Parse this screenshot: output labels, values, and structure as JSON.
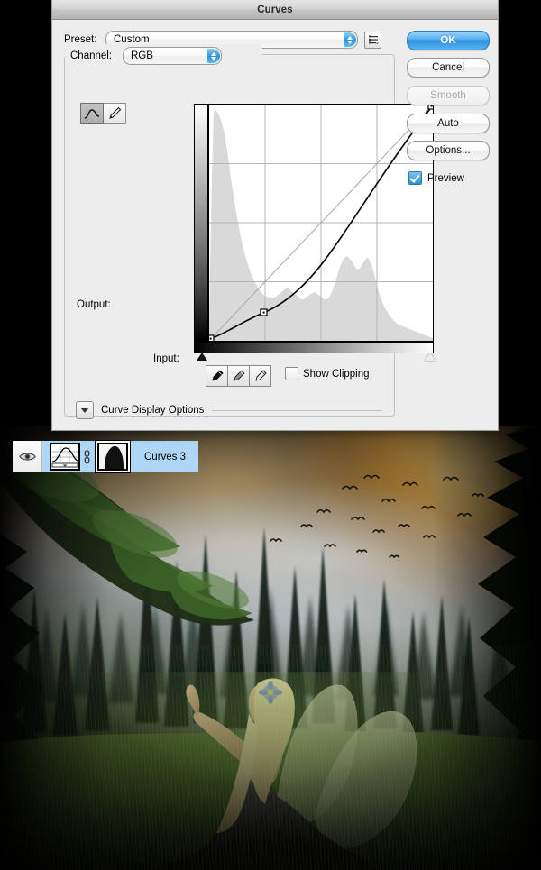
{
  "dialog": {
    "title": "Curves",
    "preset": {
      "label": "Preset:",
      "value": "Custom",
      "menu_icon": "preset-menu-icon"
    },
    "channel": {
      "label": "Channel:",
      "value": "RGB"
    },
    "tools": {
      "curve_icon": "curve-tool-icon",
      "pencil_icon": "pencil-tool-icon"
    },
    "output": {
      "label": "Output:",
      "value": ""
    },
    "input": {
      "label": "Input:",
      "value": ""
    },
    "eyedroppers": [
      {
        "name": "black-point-eyedropper-icon"
      },
      {
        "name": "gray-point-eyedropper-icon"
      },
      {
        "name": "white-point-eyedropper-icon"
      }
    ],
    "show_clipping": {
      "label": "Show Clipping",
      "checked": false
    },
    "curve_display_options": {
      "label": "Curve Display Options",
      "expanded": false,
      "icon": "disclosure-triangle-down-icon"
    },
    "buttons": {
      "ok": "OK",
      "cancel": "Cancel",
      "smooth": "Smooth",
      "auto": "Auto",
      "options": "Options..."
    },
    "preview": {
      "label": "Preview",
      "checked": true
    },
    "accent_color": "#2f8fdd"
  },
  "chart_data": {
    "type": "line",
    "title": "Curves (RGB)",
    "xlabel": "Input",
    "ylabel": "Output",
    "xlim": [
      0,
      255
    ],
    "ylim": [
      0,
      255
    ],
    "grid": true,
    "grid_divisions": 4,
    "series": [
      {
        "name": "baseline-diagonal",
        "style": "thin-gray",
        "x": [
          0,
          255
        ],
        "y": [
          0,
          255
        ]
      },
      {
        "name": "rgb-curve",
        "style": "black",
        "control_points": [
          {
            "input": 0,
            "output": 0
          },
          {
            "input": 62,
            "output": 30
          },
          {
            "input": 255,
            "output": 255
          }
        ],
        "x": [
          0,
          32,
          62,
          96,
          128,
          160,
          192,
          224,
          255
        ],
        "y": [
          0,
          14,
          30,
          52,
          80,
          116,
          158,
          204,
          255
        ]
      }
    ],
    "histogram": {
      "name": "image-histogram",
      "fill": "#d8d8d8",
      "bins": [
        6,
        62,
        98,
        100,
        97,
        94,
        90,
        86,
        80,
        74,
        68,
        62,
        56,
        50,
        45,
        40,
        36,
        33,
        30,
        27,
        25,
        23,
        22,
        20,
        19,
        18,
        18,
        17,
        17,
        17,
        18,
        19,
        20,
        21,
        22,
        22,
        21,
        20,
        19,
        18,
        17,
        16,
        16,
        17,
        18,
        19,
        20,
        20,
        19,
        18,
        17,
        16,
        16,
        17,
        19,
        22,
        26,
        31,
        37,
        43,
        48,
        52,
        55,
        56,
        55,
        53,
        50,
        48,
        47,
        48,
        50,
        53,
        55,
        54,
        50,
        45,
        39,
        33,
        28,
        24,
        20,
        17,
        15,
        13,
        12,
        11,
        10,
        9,
        9,
        8,
        8,
        7,
        7,
        6,
        6,
        5,
        5,
        4,
        4,
        3
      ]
    },
    "gradient_bars": {
      "vertical_output": [
        "#ffffff",
        "#000000"
      ],
      "horizontal_input": [
        "#000000",
        "#ffffff"
      ]
    },
    "markers": {
      "black_point": 0,
      "white_point": 255
    }
  },
  "layers_panel": {
    "row": {
      "visibility_icon": "eye-icon",
      "adjustment_thumbnail_icon": "curves-adjustment-thumbnail-icon",
      "link_icon": "link-icon",
      "mask_thumbnail_icon": "layer-mask-thumbnail-icon",
      "name": "Curves 3",
      "selected": true,
      "selection_color": "#aed6f6"
    }
  },
  "canvas": {
    "name": "fantasy-forest-fairy-composite",
    "description": "Night forest composite with golden moon, mist, flock of birds, pine silhouettes and a winged fairy kneeling on grass"
  }
}
